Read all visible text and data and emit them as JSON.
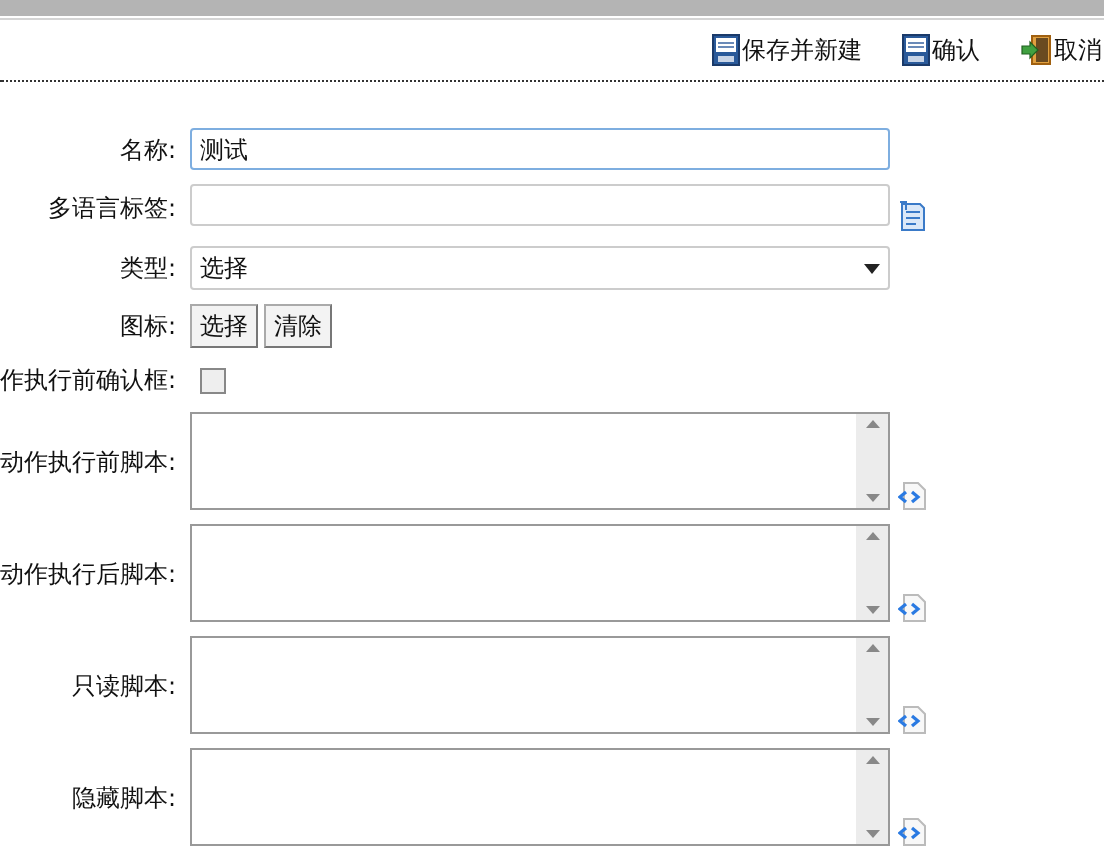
{
  "toolbar": [
    {
      "label": "保存并新建",
      "kind": "save"
    },
    {
      "label": "确认",
      "kind": "save"
    },
    {
      "label": "取消",
      "kind": "exit"
    }
  ],
  "fields": [
    {
      "label": "名称:",
      "kind": "text",
      "value": "测试",
      "focused": true
    },
    {
      "label": "多语言标签:",
      "kind": "text_icon",
      "focused": false
    },
    {
      "label": "类型:",
      "kind": "select",
      "value": "选择"
    },
    {
      "label": "图标:",
      "kind": "buttons",
      "buttons": [
        "选择",
        "清除"
      ]
    },
    {
      "label": "作执行前确认框:",
      "kind": "checkbox",
      "checked": false
    },
    {
      "label": "动作执行前脚本:",
      "kind": "script"
    },
    {
      "label": "动作执行后脚本:",
      "kind": "script"
    },
    {
      "label": "只读脚本:",
      "kind": "script"
    },
    {
      "label": "隐藏脚本:",
      "kind": "script"
    }
  ]
}
